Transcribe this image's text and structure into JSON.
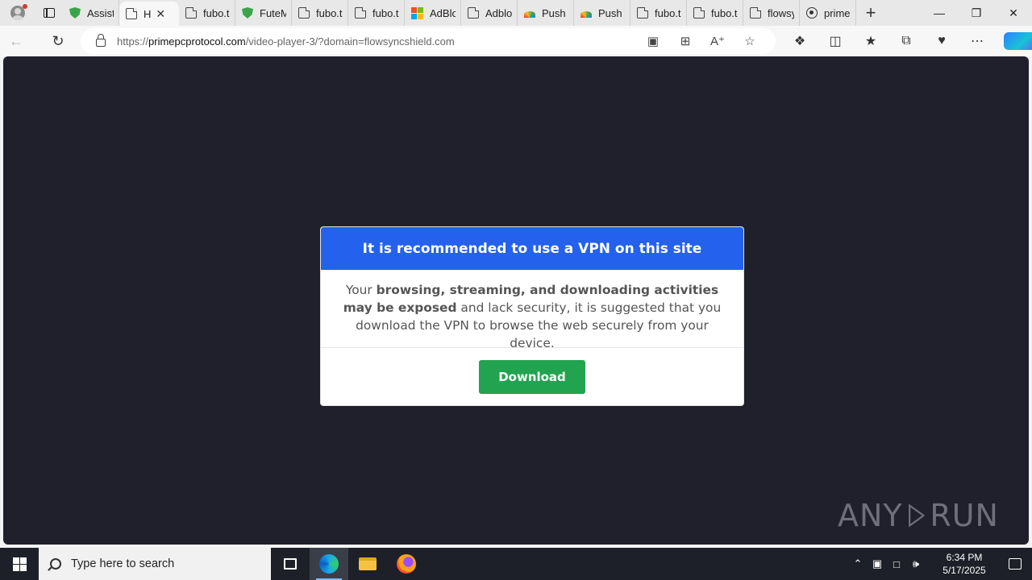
{
  "browser": {
    "tabs": [
      {
        "icon": "shield-icon",
        "label": "Assisti"
      },
      {
        "icon": "document-icon",
        "label": "H",
        "active": true
      },
      {
        "icon": "document-icon",
        "label": "fubo.t"
      },
      {
        "icon": "shield-icon",
        "label": "FuteM"
      },
      {
        "icon": "document-icon",
        "label": "fubo.t"
      },
      {
        "icon": "document-icon",
        "label": "fubo.t"
      },
      {
        "icon": "microsoft-icon",
        "label": "AdBlo"
      },
      {
        "icon": "document-icon",
        "label": "Adblo"
      },
      {
        "icon": "rainbow-icon",
        "label": "Push N"
      },
      {
        "icon": "rainbow-icon",
        "label": "Push N"
      },
      {
        "icon": "document-icon",
        "label": "fubo.t"
      },
      {
        "icon": "document-icon",
        "label": "fubo.t"
      },
      {
        "icon": "document-icon",
        "label": "flowsy"
      },
      {
        "icon": "globe-icon",
        "label": "prime"
      }
    ],
    "url_host": "primepcprotocol.com",
    "url_path": "/video-player-3/?domain=flowsyncshield.com",
    "url_scheme": "https://"
  },
  "modal": {
    "title": "It is recommended to use a VPN on this site",
    "body_prefix": "Your ",
    "body_bold": "browsing, streaming, and downloading activities may be exposed",
    "body_suffix": " and lack security, it is suggested that you download the VPN to browse the web securely from your device.",
    "button_label": "Download"
  },
  "watermark": {
    "left": "ANY",
    "right": "RUN"
  },
  "taskbar": {
    "search_placeholder": "Type here to search",
    "time": "6:34 PM",
    "date": "5/17/2025"
  },
  "colors": {
    "modal_header": "#2461ec",
    "download_button": "#22a34f",
    "page_background": "#1f202b"
  }
}
